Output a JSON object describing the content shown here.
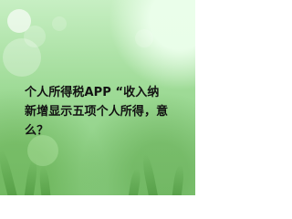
{
  "headline": {
    "line1": "个人所得税APP “收入纳",
    "line2": "新增显示五项个人所得，意",
    "line3": "么？"
  },
  "background": {
    "theme": "green-bokeh",
    "colors": [
      "#c7efc3",
      "#9fdb97",
      "#89cc80"
    ]
  }
}
